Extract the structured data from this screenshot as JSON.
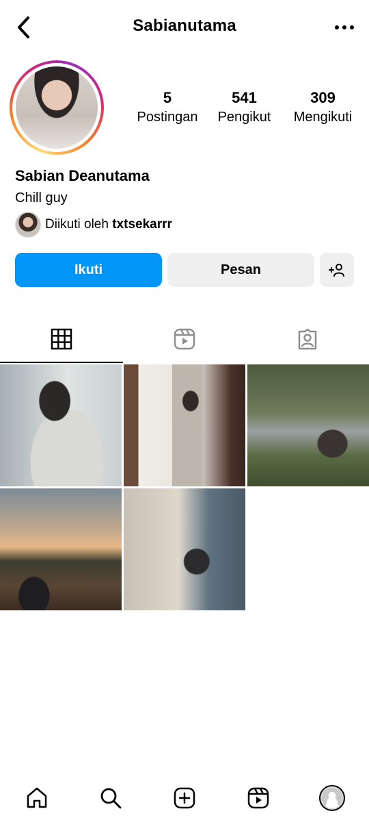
{
  "header": {
    "username": "Sabianutama",
    "back_icon": "chevron-left-icon",
    "more_icon": "more-horizontal-icon"
  },
  "profile": {
    "full_name": "Sabian Deanutama",
    "bio": "Chill guy",
    "followed_by_prefix": "Diikuti oleh",
    "followed_by_user": "txtsekarrr"
  },
  "stats": [
    {
      "value": "5",
      "label": "Postingan"
    },
    {
      "value": "541",
      "label": "Pengikut"
    },
    {
      "value": "309",
      "label": "Mengikuti"
    }
  ],
  "actions": {
    "follow_label": "Ikuti",
    "message_label": "Pesan",
    "follow_color": "#0095f6"
  },
  "tabs": [
    {
      "name": "grid-icon",
      "active": true
    },
    {
      "name": "reels-icon",
      "active": false
    },
    {
      "name": "tagged-icon",
      "active": false
    }
  ],
  "posts": [
    {
      "id": "post-1"
    },
    {
      "id": "post-2"
    },
    {
      "id": "post-3"
    },
    {
      "id": "post-4"
    },
    {
      "id": "post-5"
    }
  ],
  "bottom_nav": [
    "home-icon",
    "search-icon",
    "create-icon",
    "reels-icon",
    "profile-avatar"
  ]
}
